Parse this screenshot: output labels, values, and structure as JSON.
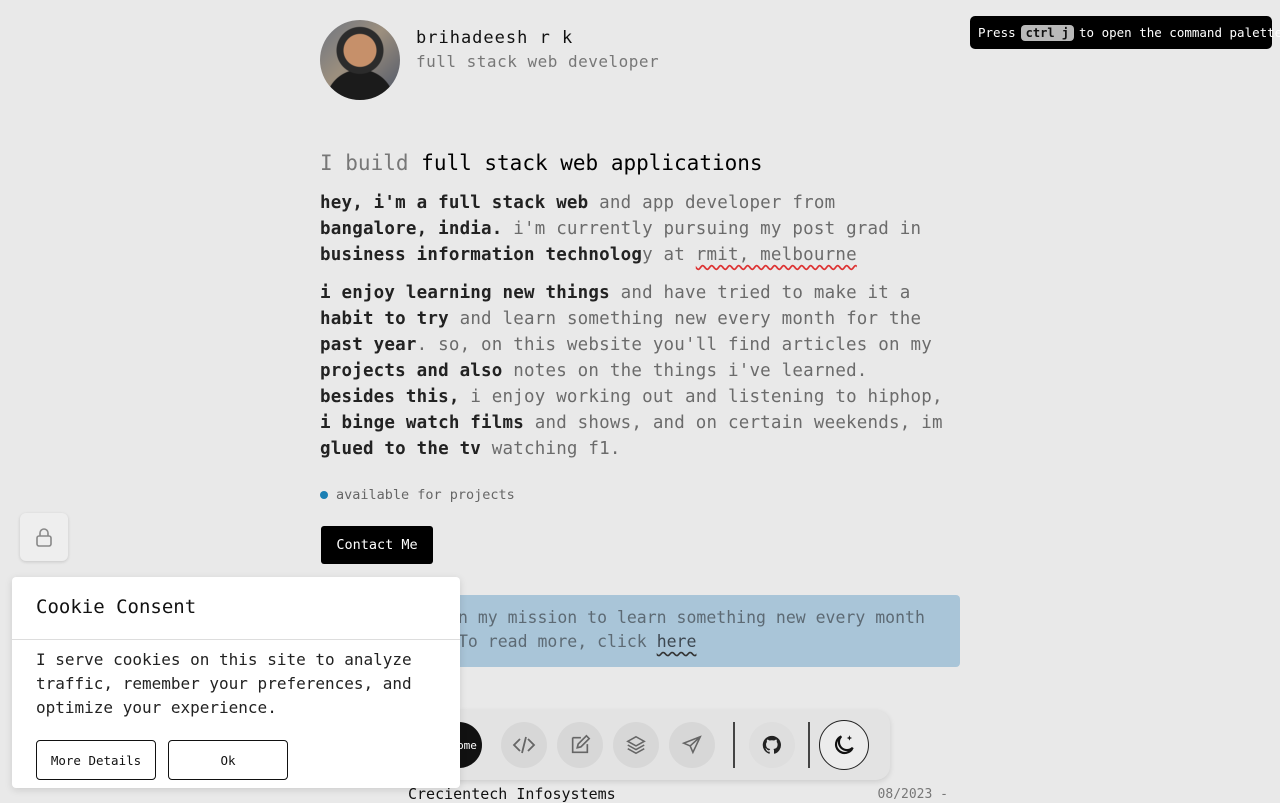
{
  "profile": {
    "name": "brihadeesh r k",
    "role": "full stack web developer"
  },
  "headline": {
    "prefix": "I build",
    "highlight": "full stack web applications"
  },
  "intro": {
    "p1_a": "hey, i'm a full stack web",
    "p1_b": " and app developer from",
    "p1_c": "bangalore, india.",
    "p1_d": " i'm currently pursuing my post grad in",
    "p1_e": "business information technolog",
    "p1_f": "y at ",
    "p1_g": "rmit, melbourne",
    "p2_a": "i enjoy learning new things",
    "p2_b": " and have tried to make it a",
    "p2_c": "habit to try",
    "p2_d": " and learn something new every month for the",
    "p2_e": "past year",
    "p2_f": ". so, on this website you'll find articles on my",
    "p2_g": "projects and also",
    "p2_h": " notes on the things i've learned.",
    "p2_i": "besides this,",
    "p2_j": " i enjoy working out and listening to hiphop,",
    "p2_k": "i binge watch films",
    "p2_l": " and shows, and on certain weekends, im",
    "p2_m": "glued to the tv",
    "p2_n": " watching f1."
  },
  "status": {
    "text": "available for projects",
    "color": "#1b7fb3"
  },
  "contact_button": "Contact Me",
  "mission": {
    "line1": "n my mission to learn something new every month",
    "line2_pre": "To read more, click ",
    "link": "here"
  },
  "palette": {
    "pre": "Press",
    "key": "ctrl j",
    "post": "to open the command palette"
  },
  "dock": {
    "home_label": "ome",
    "icons": [
      "code-icon",
      "edit-icon",
      "layers-icon",
      "send-icon",
      "github-icon",
      "moon-icon"
    ]
  },
  "experience": {
    "company": "Crecientech Infosystems",
    "date": "08/2023 -"
  },
  "cookie": {
    "title": "Cookie Consent",
    "text": "I serve cookies on this site to analyze traffic, remember your preferences, and optimize your experience.",
    "more_details": "More Details",
    "ok": "Ok"
  }
}
